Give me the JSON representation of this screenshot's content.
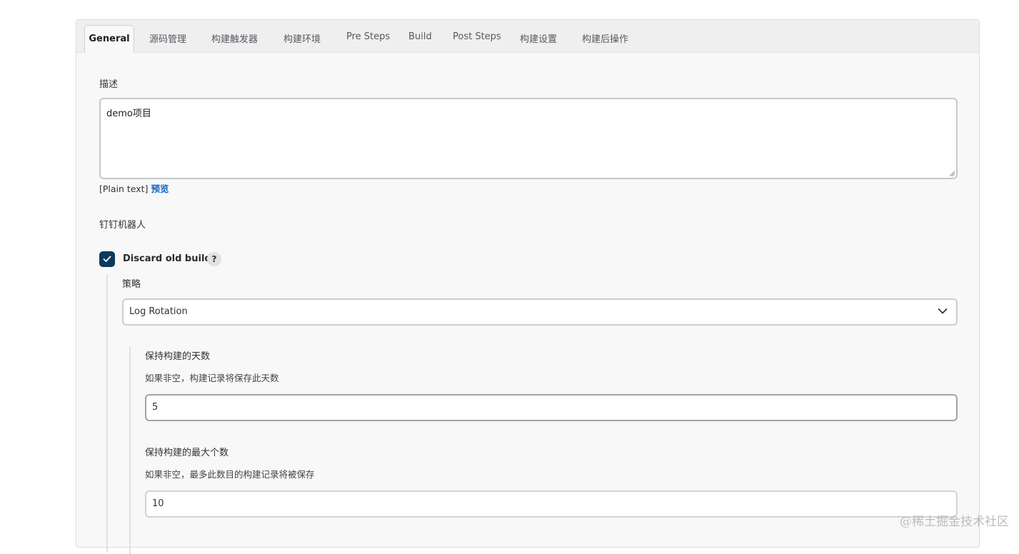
{
  "tabs": [
    "General",
    "源码管理",
    "构建触发器",
    "构建环境",
    "Pre Steps",
    "Build",
    "Post Steps",
    "构建设置",
    "构建后操作"
  ],
  "description": {
    "label": "描述",
    "value": "demo项目",
    "format_label": "[Plain text]",
    "preview_link": "预览"
  },
  "dingtalk_label": "钉钉机器人",
  "discard_old_builds": {
    "label": "Discard old builds",
    "checked": true,
    "help_symbol": "?"
  },
  "strategy": {
    "label": "策略",
    "selected": "Log Rotation"
  },
  "days_to_keep": {
    "label": "保持构建的天数",
    "description": "如果非空，构建记录将保存此天数",
    "value": "5"
  },
  "max_builds": {
    "label": "保持构建的最大个数",
    "description": "如果非空，最多此数目的构建记录将被保存",
    "value": "10"
  },
  "watermark": "@稀土掘金技术社区",
  "colors": {
    "checkbox": "#0d3a5c",
    "link": "#1565c0",
    "panel_bg": "#f8f8f8"
  }
}
